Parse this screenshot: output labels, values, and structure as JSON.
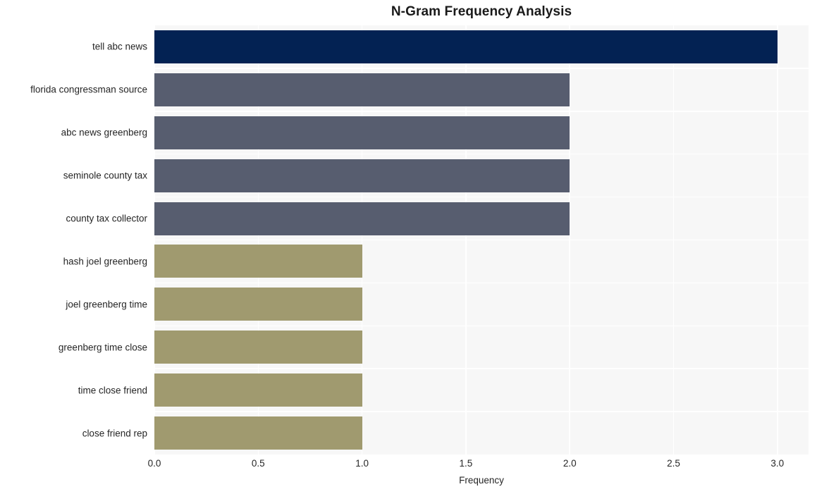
{
  "chart_data": {
    "type": "bar",
    "orientation": "horizontal",
    "title": "N-Gram Frequency Analysis",
    "xlabel": "Frequency",
    "ylabel": "",
    "categories": [
      "tell abc news",
      "florida congressman source",
      "abc news greenberg",
      "seminole county tax",
      "county tax collector",
      "hash joel greenberg",
      "joel greenberg time",
      "greenberg time close",
      "time close friend",
      "close friend rep"
    ],
    "values": [
      3,
      2,
      2,
      2,
      2,
      1,
      1,
      1,
      1,
      1
    ],
    "bar_colors": [
      "#032253",
      "#575d6f",
      "#575d6f",
      "#575d6f",
      "#575d6f",
      "#a09a6f",
      "#a09a6f",
      "#a09a6f",
      "#a09a6f",
      "#a09a6f"
    ],
    "xlim": [
      0,
      3.15
    ],
    "xticks": [
      0,
      0.5,
      1,
      1.5,
      2,
      2.5,
      3
    ],
    "xticklabels": [
      "0.0",
      "0.5",
      "1.0",
      "1.5",
      "2.0",
      "2.5",
      "3.0"
    ],
    "grid": true,
    "grid_color": "#ffffff",
    "plot_background": "#f7f7f7",
    "figure_background": "#ffffff",
    "legend": null
  }
}
